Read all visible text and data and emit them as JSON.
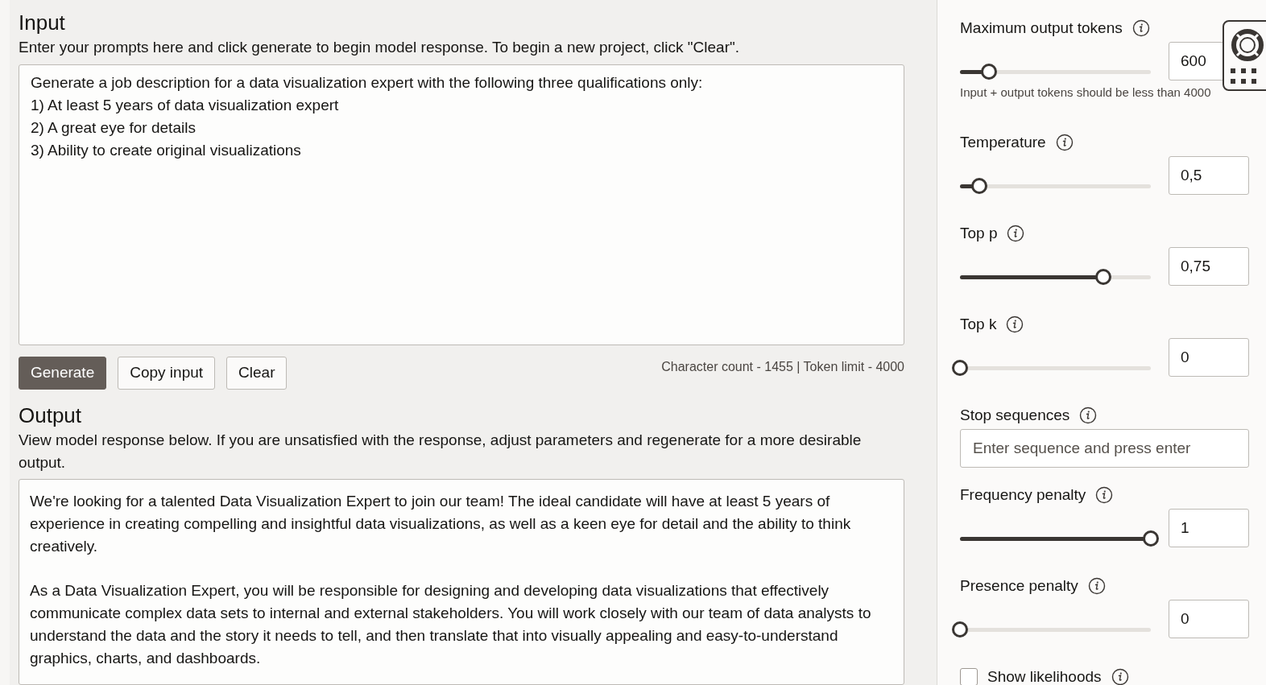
{
  "input": {
    "title": "Input",
    "description": "Enter your prompts here and click generate to begin model response. To begin a new project, click \"Clear\".",
    "prompt": "Generate a job description for a data visualization expert with the following three qualifications only:\n1) At least 5 years of data visualization expert\n2) A great eye for details\n3) Ability to create original visualizations",
    "buttons": [
      {
        "label": "Generate",
        "kind": "primary"
      },
      {
        "label": "Copy input",
        "kind": "secondary"
      },
      {
        "label": "Clear",
        "kind": "secondary"
      }
    ],
    "counter": "Character count - 1455 | Token limit - 4000"
  },
  "output": {
    "title": "Output",
    "description": "View model response below. If you are unsatisfied with the response, adjust parameters and regenerate for a more desirable output.",
    "paragraphs": [
      "We're looking for a talented Data Visualization Expert to join our team! The ideal candidate will have at least 5 years of experience in creating compelling and insightful data visualizations, as well as a keen eye for detail and the ability to think creatively.",
      "As a Data Visualization Expert, you will be responsible for designing and developing data visualizations that effectively communicate complex data sets to internal and external stakeholders. You will work closely with our team of data analysts to understand the data and the story it needs to tell, and then translate that into visually appealing and easy-to-understand graphics, charts, and dashboards."
    ]
  },
  "parameters": [
    {
      "kind": "slider",
      "label": "Maximum output tokens",
      "level": 0.15,
      "value": "600",
      "hint": "Input + output tokens should be less than 4000"
    },
    {
      "kind": "slider",
      "label": "Temperature",
      "level": 0.1,
      "value": "0,5"
    },
    {
      "kind": "slider",
      "label": "Top p",
      "level": 0.75,
      "value": "0,75"
    },
    {
      "kind": "slider",
      "label": "Top k",
      "level": 0,
      "value": "0"
    },
    {
      "kind": "text",
      "label": "Stop sequences",
      "placeholder": "Enter sequence and press enter"
    },
    {
      "kind": "slider",
      "label": "Frequency penalty",
      "level": 1,
      "value": "1"
    },
    {
      "kind": "slider",
      "label": "Presence penalty",
      "level": 0,
      "value": "0"
    },
    {
      "kind": "checkbox",
      "label": "Show likelihoods",
      "checked": false
    }
  ]
}
